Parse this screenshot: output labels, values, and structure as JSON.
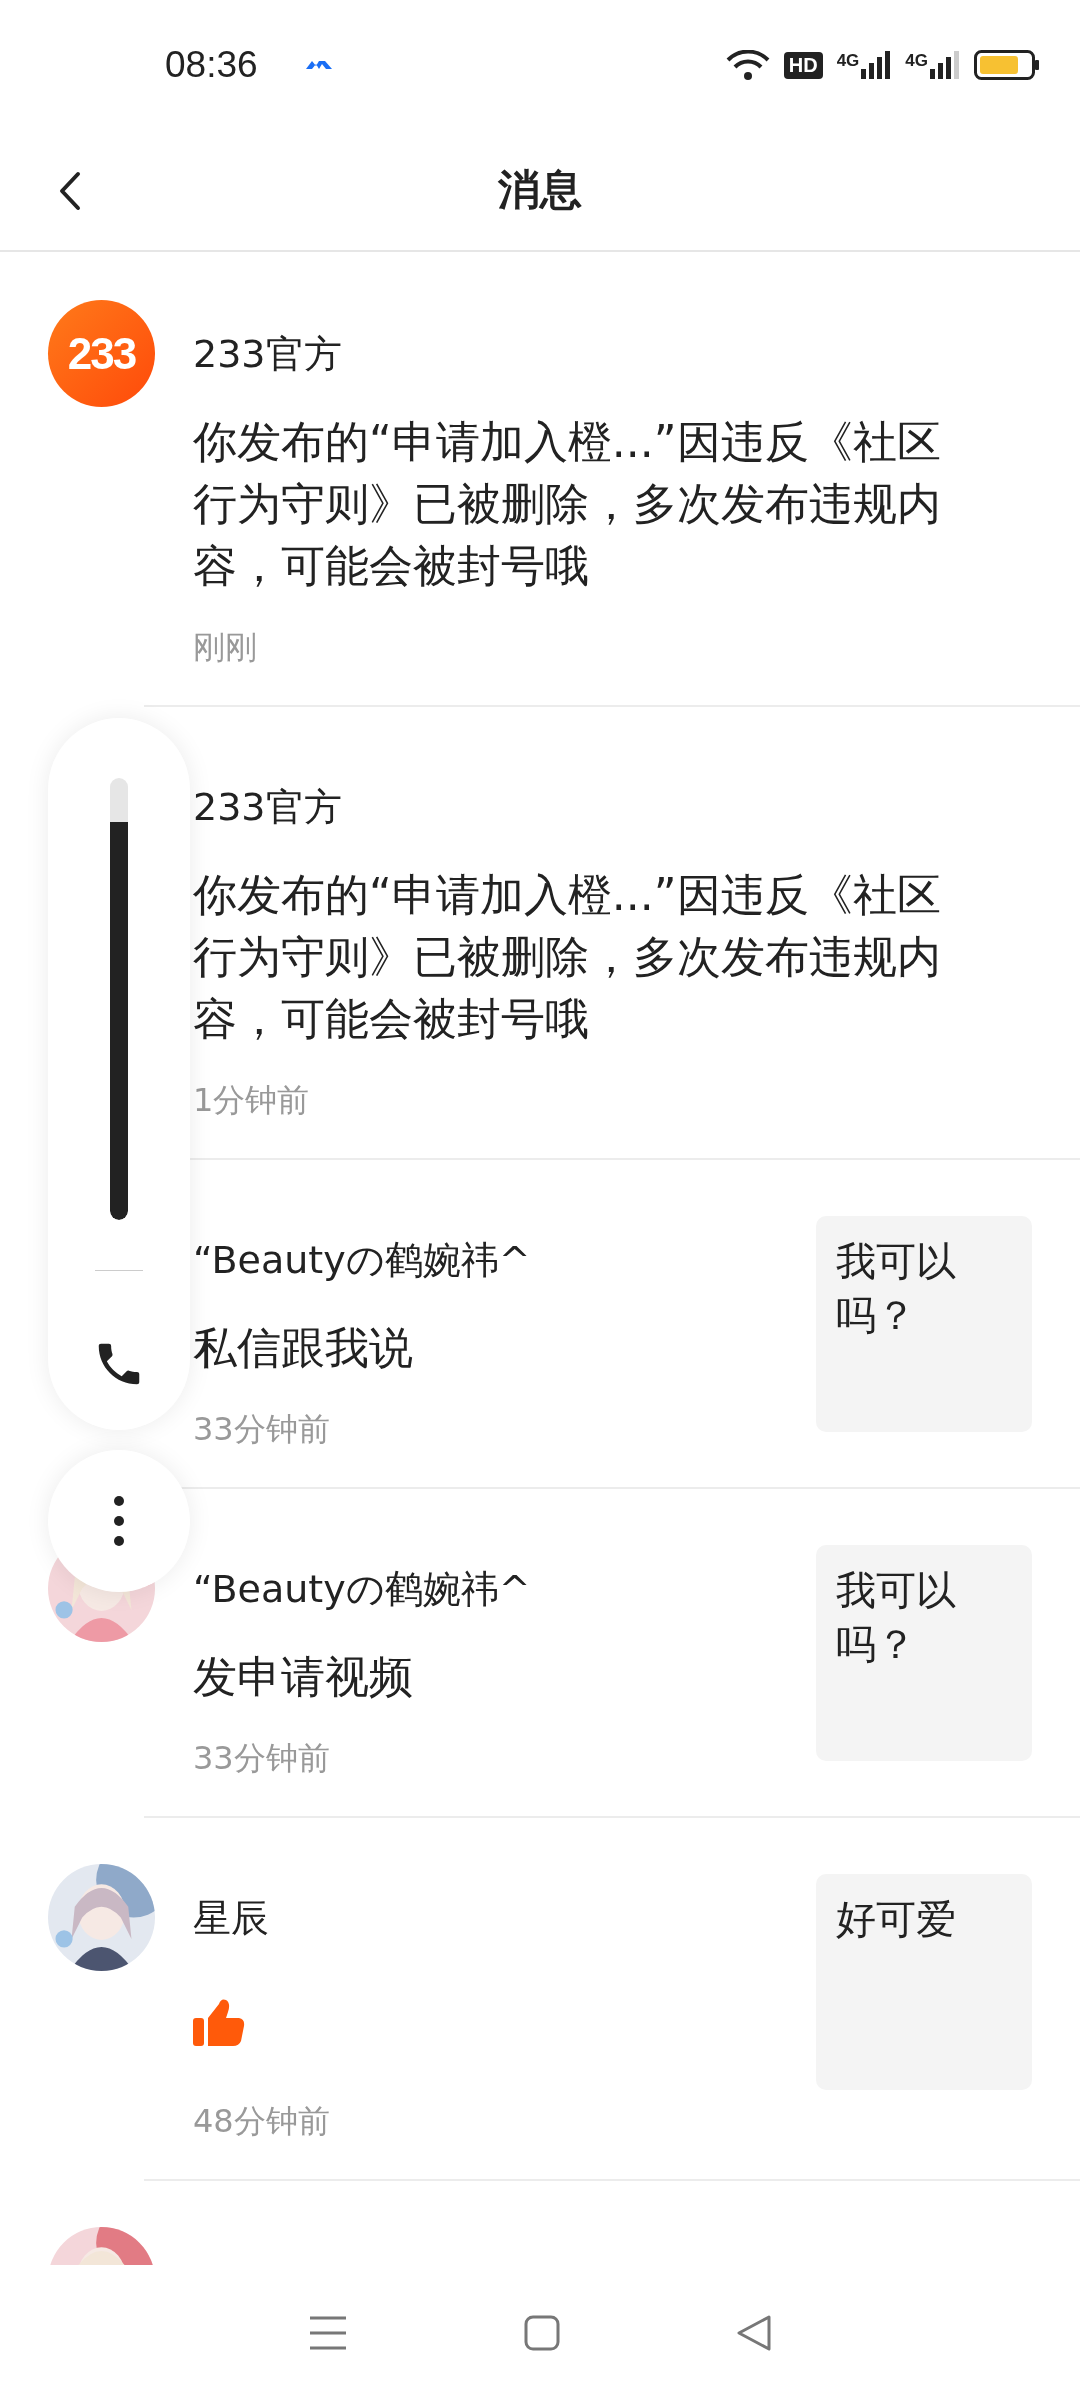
{
  "status_bar": {
    "time": "08:36",
    "hd_label": "HD",
    "network_labels": [
      "4G",
      "4G"
    ]
  },
  "header": {
    "title": "消息"
  },
  "messages": [
    {
      "avatar": {
        "kind": "logo",
        "text": "233"
      },
      "sender": "233官方",
      "content": {
        "kind": "text",
        "text": "你发布的“申请加入橙...”因违反《社区行为守则》已被删除，多次发布违规内容，可能会被封号哦"
      },
      "time": "刚刚"
    },
    {
      "sender": "233官方",
      "content": {
        "kind": "text",
        "text": "你发布的“申请加入橙...”因违反《社区行为守则》已被删除，多次发布违规内容，可能会被封号哦"
      },
      "time": "1分钟前"
    },
    {
      "sender": "“Beautyの鹤婉祎^",
      "content": {
        "kind": "text",
        "text": "私信跟我说"
      },
      "time": "33分钟前",
      "quote": "我可以吗？"
    },
    {
      "avatar": {
        "kind": "picture"
      },
      "sender": "“Beautyの鹤婉祎^",
      "content": {
        "kind": "text",
        "text": "发申请视频"
      },
      "time": "33分钟前",
      "quote": "我可以吗？"
    },
    {
      "avatar": {
        "kind": "picture"
      },
      "sender": "星辰",
      "content": {
        "kind": "like"
      },
      "time": "48分钟前",
      "quote": "好可爱"
    },
    {
      "avatar": {
        "kind": "picture"
      }
    }
  ],
  "floating_panel": {
    "level": 0.9
  }
}
